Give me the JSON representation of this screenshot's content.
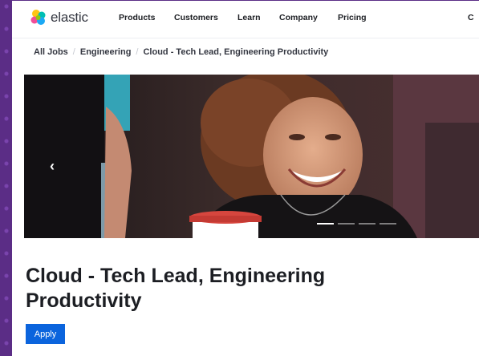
{
  "brand": {
    "name": "elastic",
    "logo_icon": "elastic-cluster-logo"
  },
  "nav": {
    "items": [
      {
        "label": "Products"
      },
      {
        "label": "Customers"
      },
      {
        "label": "Learn"
      },
      {
        "label": "Company"
      },
      {
        "label": "Pricing"
      }
    ],
    "overflow_label": "C"
  },
  "breadcrumb": {
    "items": [
      {
        "label": "All Jobs"
      },
      {
        "label": "Engineering"
      },
      {
        "label": "Cloud - Tech Lead, Engineering Productivity"
      }
    ],
    "separator": "/"
  },
  "carousel": {
    "prev_icon": "chevron-left-icon",
    "slide_count": 4,
    "active_slide": 1
  },
  "job": {
    "title": "Cloud - Tech Lead, Engineering Productivity",
    "apply_label": "Apply"
  },
  "colors": {
    "accent": "#0b64dd",
    "text": "#1c1e23",
    "background_frame": "#5b2d86"
  }
}
